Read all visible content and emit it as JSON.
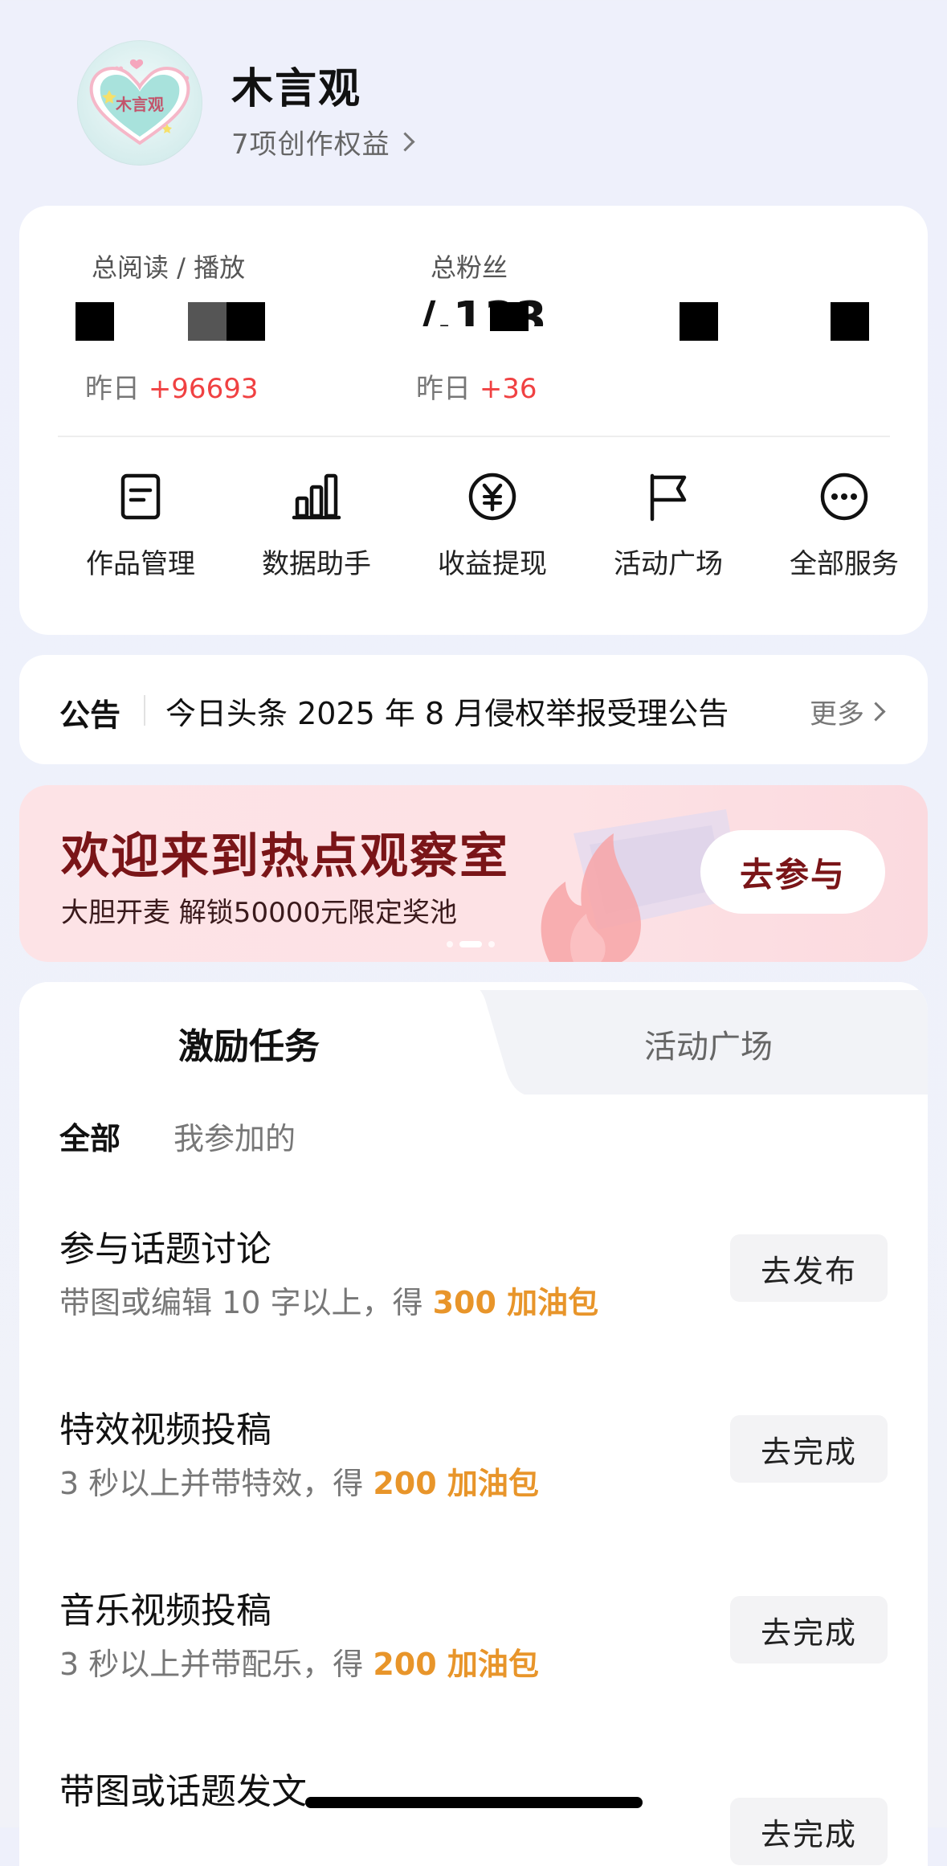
{
  "profile": {
    "name": "木言观",
    "rights": "7项创作权益",
    "avatar_text": "木言观"
  },
  "stats": {
    "reads": {
      "label": "总阅读 / 播放",
      "delta_prefix": "昨日",
      "delta_value": "+96693"
    },
    "fans": {
      "label": "总粉丝",
      "value_partial": "/,133",
      "delta_prefix": "昨日",
      "delta_value": "+36"
    }
  },
  "tools": [
    {
      "label": "作品管理",
      "icon": "document-icon"
    },
    {
      "label": "数据助手",
      "icon": "bar-chart-icon"
    },
    {
      "label": "收益提现",
      "icon": "yuan-coin-icon"
    },
    {
      "label": "活动广场",
      "icon": "flag-icon"
    },
    {
      "label": "全部服务",
      "icon": "more-circle-icon"
    }
  ],
  "notice": {
    "tag": "公告",
    "text": "今日头条 2025 年 8 月侵权举报受理公告",
    "more": "更多"
  },
  "banner": {
    "title": "欢迎来到热点观察室",
    "subtitle": "大胆开麦 解锁50000元限定奖池",
    "button": "去参与",
    "dots": 3,
    "active_dot": 1
  },
  "task_tabs": [
    {
      "label": "激励任务",
      "active": true
    },
    {
      "label": "活动广场",
      "active": false
    }
  ],
  "filters": [
    {
      "label": "全部",
      "active": true
    },
    {
      "label": "我参加的",
      "active": false
    }
  ],
  "tasks": [
    {
      "title": "参与话题讨论",
      "desc": "带图或编辑 10 字以上，得 ",
      "reward": "300 加油包",
      "button": "去发布"
    },
    {
      "title": "特效视频投稿",
      "desc": "3 秒以上并带特效，得 ",
      "reward": "200 加油包",
      "button": "去完成"
    },
    {
      "title": "音乐视频投稿",
      "desc": "3 秒以上并带配乐，得 ",
      "reward": "200 加油包",
      "button": "去完成"
    },
    {
      "title": "带图或话题发文",
      "desc": "",
      "reward": "",
      "button": "去完成"
    }
  ],
  "colors": {
    "accent_red": "#f04142",
    "reward_orange": "#e8952a",
    "banner_title": "#7a1518"
  }
}
